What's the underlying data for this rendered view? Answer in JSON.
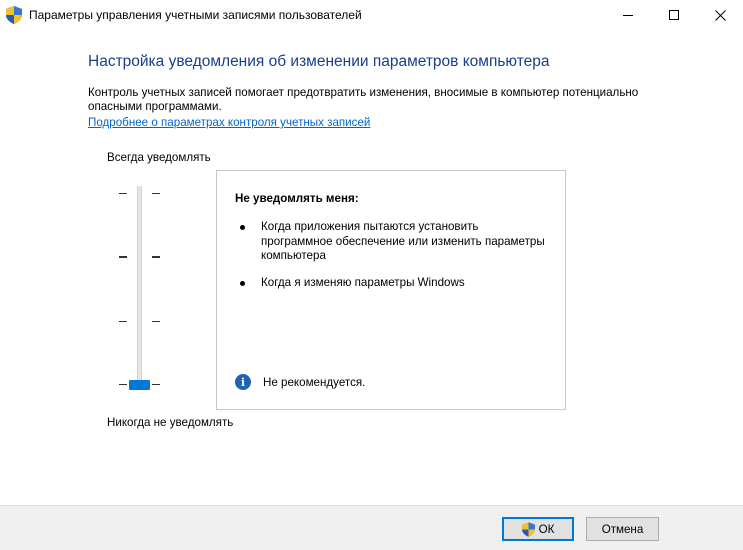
{
  "window": {
    "title": "Параметры управления учетными записями пользователей",
    "controls": [
      "minimize-icon",
      "maximize-icon",
      "close-icon"
    ]
  },
  "main": {
    "heading": "Настройка уведомления об изменении параметров компьютера",
    "description": "Контроль учетных записей помогает предотвратить изменения, вносимые в компьютер потенциально опасными программами.",
    "link": "Подробнее о параметрах контроля учетных записей"
  },
  "slider": {
    "label_top": "Всегда уведомлять",
    "label_bottom": "Никогда не уведомлять",
    "levels": 4,
    "selected_level": 1,
    "accent_color": "#0078d7"
  },
  "infobox": {
    "title": "Не уведомлять меня:",
    "items": [
      "Когда приложения пытаются установить программное обеспечение или изменить параметры компьютера",
      "Когда я изменяю параметры Windows"
    ],
    "note": "Не рекомендуется.",
    "note_icon": "info-icon"
  },
  "footer": {
    "ok_label": "ОК",
    "cancel_label": "Отмена"
  },
  "colors": {
    "heading": "#1a3e8c",
    "link": "#0066cc",
    "shield_blue": "#2a5db0",
    "shield_yellow": "#f2c12e"
  }
}
